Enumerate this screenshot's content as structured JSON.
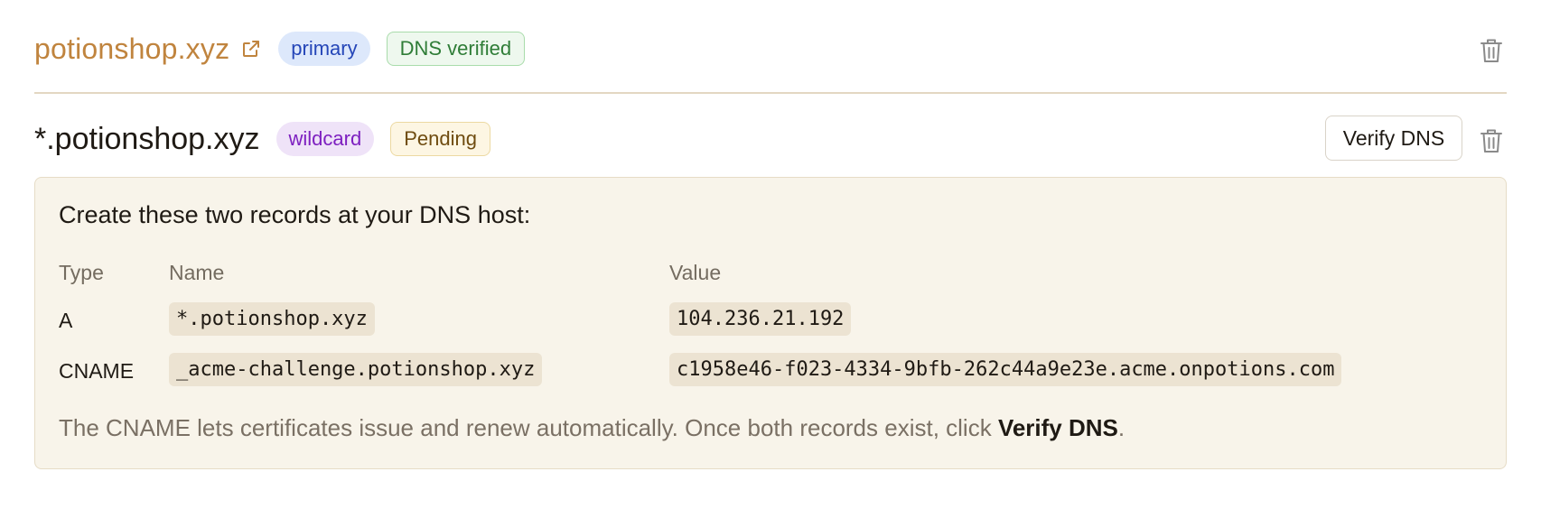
{
  "primary_domain": {
    "name": "potionshop.xyz",
    "badges": {
      "primary": "primary",
      "status": "DNS verified"
    }
  },
  "wildcard_domain": {
    "name": "*.potionshop.xyz",
    "badges": {
      "type": "wildcard",
      "status": "Pending"
    },
    "verify_button": "Verify DNS"
  },
  "dns_panel": {
    "title": "Create these two records at your DNS host:",
    "headers": {
      "type": "Type",
      "name": "Name",
      "value": "Value"
    },
    "records": [
      {
        "type": "A",
        "name": "*.potionshop.xyz",
        "value": "104.236.21.192"
      },
      {
        "type": "CNAME",
        "name": "_acme-challenge.potionshop.xyz",
        "value": "c1958e46-f023-4334-9bfb-262c44a9e23e.acme.onpotions.com"
      }
    ],
    "note_text": "The CNAME lets certificates issue and renew automatically. Once both records exist, click ",
    "note_bold": "Verify DNS",
    "note_end": "."
  },
  "colors": {
    "link": "#c0843e",
    "primary_badge": "#2546b8",
    "verified_badge": "#2f7d37",
    "wildcard_badge": "#7d1fc0",
    "pending_badge": "#6f4c10",
    "panel_bg": "#f8f4ea"
  },
  "icons": [
    "external-link-icon",
    "trash-icon"
  ]
}
